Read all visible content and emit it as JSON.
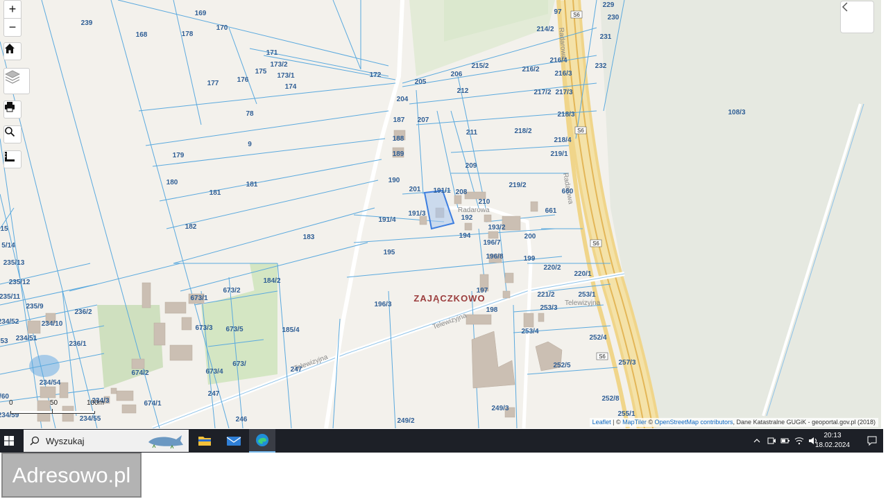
{
  "map": {
    "place_name": "ZAJĄCZKOWO",
    "streets": [
      "Radarowa",
      "Radarowa",
      "Radarowa",
      "Telewizyjna",
      "Telewizyjna",
      "Telewizyjna",
      "S6",
      "S6",
      "S6",
      "S6"
    ],
    "parcels": [
      "239",
      "169",
      "168",
      "178",
      "170",
      "171",
      "173/2",
      "173/1",
      "175",
      "176",
      "177",
      "174",
      "172",
      "205",
      "206",
      "215/2",
      "216/2",
      "214/2",
      "97",
      "229",
      "230",
      "231",
      "232",
      "216/4",
      "216/3",
      "217/2",
      "217/3",
      "218/3",
      "218/2",
      "218/4",
      "219/1",
      "212",
      "204",
      "207",
      "211",
      "187",
      "188",
      "189",
      "209",
      "190",
      "201",
      "191/1",
      "208",
      "210",
      "219/2",
      "660",
      "661",
      "191/3",
      "191/4",
      "192",
      "193/2",
      "200",
      "194",
      "196/7",
      "196/8",
      "199",
      "220/2",
      "220/1",
      "195",
      "183",
      "184/2",
      "673/2",
      "673/1",
      "673/3",
      "673/5",
      "673/",
      "673/4",
      "185/4",
      "196/3",
      "197",
      "198",
      "221/2",
      "253/1",
      "253/3",
      "253/4",
      "252/4",
      "252/5",
      "257/3",
      "252/8",
      "255/1",
      "249/3",
      "249/2",
      "246",
      "247",
      "247",
      "674/2",
      "674/1",
      "234/3",
      "234/55",
      "234/54",
      "234/59",
      "/60",
      "236/2",
      "236/1",
      "234/10",
      "234/51",
      "234/52",
      "235/9",
      "235/11",
      "235/12",
      "235/13",
      "5/14",
      "15",
      "53",
      "179",
      "180",
      "181",
      "181",
      "182",
      "108/3",
      "78",
      "9"
    ],
    "selected_parcel": "191/1"
  },
  "controls": {
    "zoom_in": "+",
    "zoom_out": "−"
  },
  "scale": {
    "zero": "0",
    "mid": "50",
    "max": "100m"
  },
  "attribution": {
    "leaflet": "Leaflet",
    "sep1": " | © ",
    "maptiler": "MapTiler",
    "sep2": " © ",
    "osm": "OpenStreetMap contributors",
    "rest": ", Dane Katastralne GUGiK - geoportal.gov.pl (2018)"
  },
  "taskbar": {
    "search_placeholder": "Wyszukaj",
    "time": "20:13",
    "date": "18.02.2024"
  },
  "watermark": "Adresowo.pl"
}
